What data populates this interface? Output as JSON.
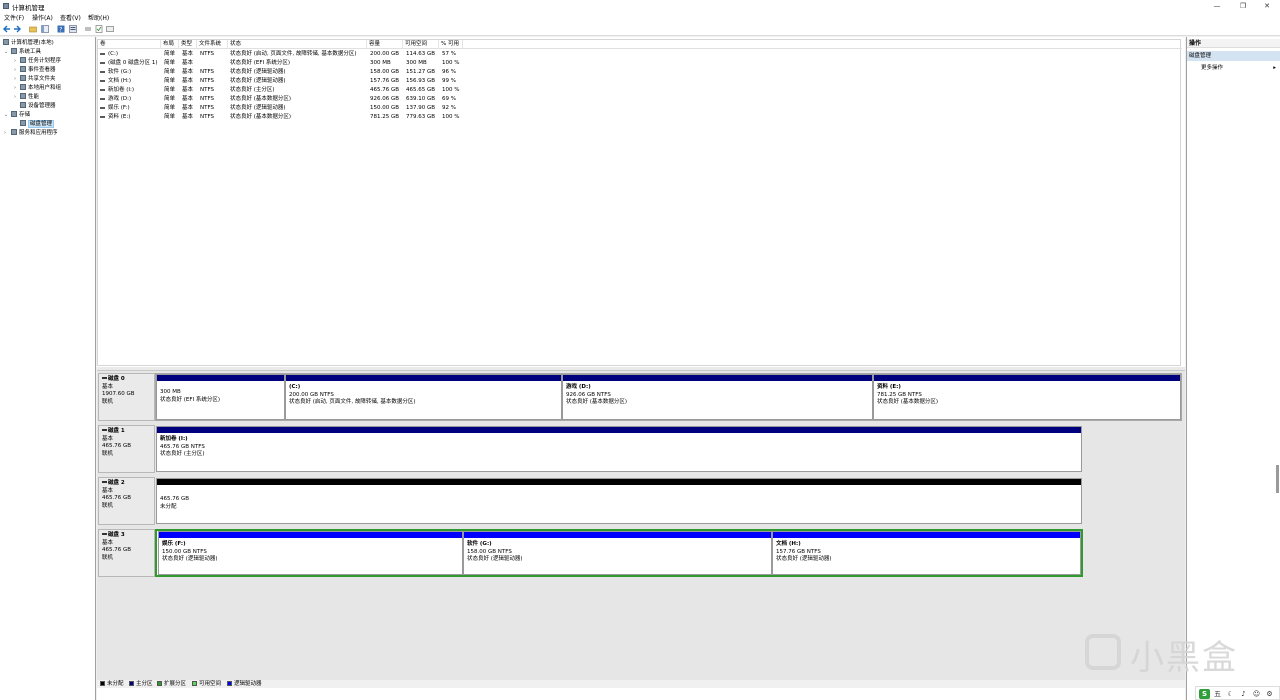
{
  "window": {
    "title": "计算机管理",
    "buttons": {
      "minimize": "—",
      "restore": "❐",
      "close": "✕"
    }
  },
  "menubar": [
    "文件(F)",
    "操作(A)",
    "查看(V)",
    "帮助(H)"
  ],
  "tree": [
    {
      "label": "计算机管理(本地)",
      "expander": ""
    },
    {
      "label": "系统工具",
      "expander": "⌄"
    },
    {
      "label": "任务计划程序",
      "expander": "›"
    },
    {
      "label": "事件查看器",
      "expander": "›"
    },
    {
      "label": "共享文件夹",
      "expander": "›"
    },
    {
      "label": "本地用户和组",
      "expander": "›"
    },
    {
      "label": "性能",
      "expander": "›"
    },
    {
      "label": "设备管理器",
      "expander": ""
    },
    {
      "label": "存储",
      "expander": "⌄"
    },
    {
      "label": "磁盘管理",
      "expander": ""
    },
    {
      "label": "服务和应用程序",
      "expander": "›"
    }
  ],
  "volume_table": {
    "columns": [
      "卷",
      "布局",
      "类型",
      "文件系统",
      "状态",
      "容量",
      "可用空间",
      "% 可用"
    ],
    "rows": [
      [
        "(C:)",
        "简单",
        "基本",
        "NTFS",
        "状态良好 (启动, 页面文件, 故障转储, 基本数据分区)",
        "200.00 GB",
        "114.63 GB",
        "57 %"
      ],
      [
        "(磁盘 0 磁盘分区 1)",
        "简单",
        "基本",
        "",
        "状态良好 (EFI 系统分区)",
        "300 MB",
        "300 MB",
        "100 %"
      ],
      [
        "软件 (G:)",
        "简单",
        "基本",
        "NTFS",
        "状态良好 (逻辑驱动器)",
        "158.00 GB",
        "151.27 GB",
        "96 %"
      ],
      [
        "文档 (H:)",
        "简单",
        "基本",
        "NTFS",
        "状态良好 (逻辑驱动器)",
        "157.76 GB",
        "156.93 GB",
        "99 %"
      ],
      [
        "新加卷 (I:)",
        "简单",
        "基本",
        "NTFS",
        "状态良好 (主分区)",
        "465.76 GB",
        "465.65 GB",
        "100 %"
      ],
      [
        "游戏 (D:)",
        "简单",
        "基本",
        "NTFS",
        "状态良好 (基本数据分区)",
        "926.06 GB",
        "639.10 GB",
        "69 %"
      ],
      [
        "娱乐 (F:)",
        "简单",
        "基本",
        "NTFS",
        "状态良好 (逻辑驱动器)",
        "150.00 GB",
        "137.90 GB",
        "92 %"
      ],
      [
        "资料 (E:)",
        "简单",
        "基本",
        "NTFS",
        "状态良好 (基本数据分区)",
        "781.25 GB",
        "779.63 GB",
        "100 %"
      ]
    ]
  },
  "disks": [
    {
      "name": "磁盘 0",
      "type": "基本",
      "size": "1907.60 GB",
      "status": "联机",
      "partitions": [
        {
          "title": "",
          "size": "300 MB",
          "status": "状态良好 (EFI 系统分区)",
          "bar_color": "#00007f"
        },
        {
          "title": "(C:)",
          "size": "200.00 GB NTFS",
          "status": "状态良好 (启动, 页面文件, 故障转储, 基本数据分区)",
          "bar_color": "#00007f"
        },
        {
          "title": "游戏 (D:)",
          "size": "926.06 GB NTFS",
          "status": "状态良好 (基本数据分区)",
          "bar_color": "#00007f"
        },
        {
          "title": "资料 (E:)",
          "size": "781.25 GB NTFS",
          "status": "状态良好 (基本数据分区)",
          "bar_color": "#00007f"
        }
      ]
    },
    {
      "name": "磁盘 1",
      "type": "基本",
      "size": "465.76 GB",
      "status": "联机",
      "partitions": [
        {
          "title": "新加卷 (I:)",
          "size": "465.76 GB NTFS",
          "status": "状态良好 (主分区)",
          "bar_color": "#00007f"
        }
      ]
    },
    {
      "name": "磁盘 2",
      "type": "基本",
      "size": "465.76 GB",
      "status": "联机",
      "partitions": [
        {
          "title": "",
          "size": "465.76 GB",
          "status": "未分配",
          "bar_color": "#000000"
        }
      ]
    },
    {
      "name": "磁盘 3",
      "type": "基本",
      "size": "465.76 GB",
      "status": "联机",
      "partitions": [
        {
          "title": "娱乐 (F:)",
          "size": "150.00 GB NTFS",
          "status": "状态良好 (逻辑驱动器)",
          "bar_color": "#0000ff"
        },
        {
          "title": "软件 (G:)",
          "size": "158.00 GB NTFS",
          "status": "状态良好 (逻辑驱动器)",
          "bar_color": "#0000ff"
        },
        {
          "title": "文档 (H:)",
          "size": "157.76 GB NTFS",
          "status": "状态良好 (逻辑驱动器)",
          "bar_color": "#0000ff"
        }
      ]
    }
  ],
  "legend": [
    {
      "label": "未分配",
      "color": "#000000"
    },
    {
      "label": "主分区",
      "color": "#00007f"
    },
    {
      "label": "扩展分区",
      "color": "#2f9b2f"
    },
    {
      "label": "可用空间",
      "color": "#5cd65c"
    },
    {
      "label": "逻辑驱动器",
      "color": "#0000ff"
    }
  ],
  "actions": {
    "header": "操作",
    "section": "磁盘管理",
    "more": "更多操作"
  },
  "watermark": "小黑盒",
  "tray": {
    "logo": "S",
    "items": [
      "五",
      "☾",
      "♪",
      "☺",
      "⚙"
    ]
  }
}
